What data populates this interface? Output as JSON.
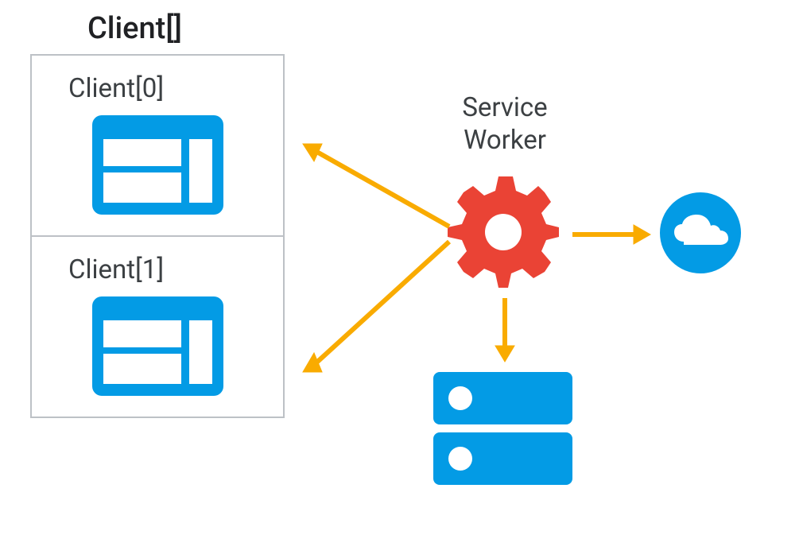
{
  "clients": {
    "title": "Client[]",
    "items": [
      {
        "label": "Client[0]"
      },
      {
        "label": "Client[1]"
      }
    ]
  },
  "serviceWorker": {
    "label": "Service\nWorker"
  },
  "colors": {
    "blue": "#039be5",
    "red": "#ea4335",
    "orange": "#f9ab00",
    "gray": "#bdc1c6",
    "text": "#3c4043",
    "titleText": "#202124"
  },
  "nodes": {
    "client0": "browser-window-icon",
    "client1": "browser-window-icon",
    "serviceWorker": "gear-icon",
    "storage": "server-icon",
    "network": "cloud-icon"
  },
  "arrows": [
    {
      "from": "serviceWorker",
      "to": "client0",
      "direction": "left-up"
    },
    {
      "from": "serviceWorker",
      "to": "client1",
      "direction": "left-down"
    },
    {
      "from": "serviceWorker",
      "to": "storage",
      "direction": "down"
    },
    {
      "from": "serviceWorker",
      "to": "network",
      "direction": "right"
    }
  ]
}
